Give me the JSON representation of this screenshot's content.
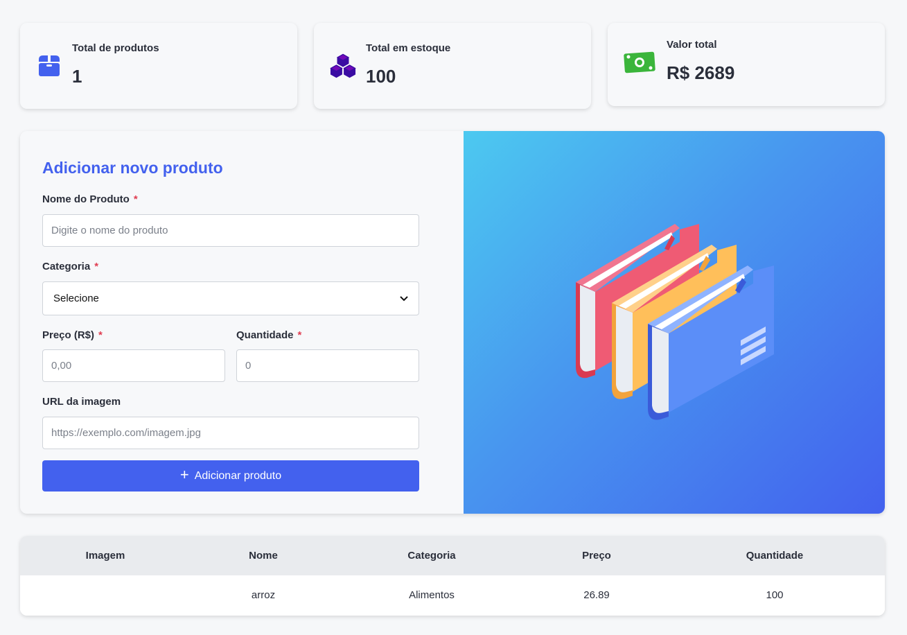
{
  "colors": {
    "primary": "#4361ee",
    "required": "#e03e52",
    "cash_green": "#3bb53b",
    "cubes_purple": "#3a0ca3"
  },
  "stats": [
    {
      "label": "Total de produtos",
      "value": "1",
      "icon": "box-icon"
    },
    {
      "label": "Total em estoque",
      "value": "100",
      "icon": "cubes-icon"
    },
    {
      "label": "Valor total",
      "value": "R$ 2689",
      "icon": "money-bill-icon"
    }
  ],
  "form": {
    "title": "Adicionar novo produto",
    "name_label": "Nome do Produto",
    "name_placeholder": "Digite o nome do produto",
    "category_label": "Categoria",
    "category_selected": "Selecione",
    "price_label": "Preço (R$)",
    "price_placeholder": "0,00",
    "quantity_label": "Quantidade",
    "quantity_placeholder": "0",
    "image_label": "URL da imagem",
    "image_placeholder": "https://exemplo.com/imagem.jpg",
    "required_mark": "*",
    "submit_label": "Adicionar produto"
  },
  "table": {
    "columns": [
      "Imagem",
      "Nome",
      "Categoria",
      "Preço",
      "Quantidade"
    ],
    "rows": [
      {
        "image": "",
        "name": "arroz",
        "category": "Alimentos",
        "price": "26.89",
        "quantity": "100"
      }
    ]
  }
}
